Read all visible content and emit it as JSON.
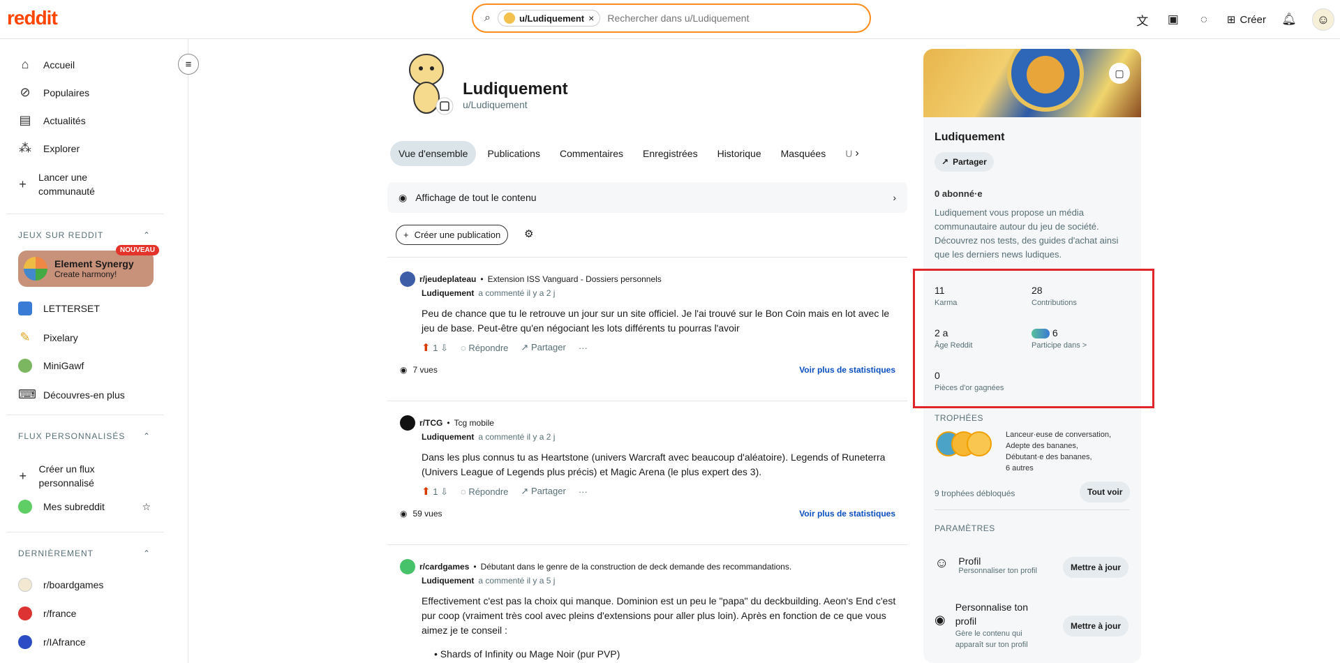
{
  "header": {
    "logo": "reddit",
    "search_chip": "u/Ludiquement",
    "search_placeholder": "Rechercher dans u/Ludiquement",
    "create_label": "Créer"
  },
  "sidebar": {
    "nav": [
      {
        "label": "Accueil",
        "icon": "home-icon"
      },
      {
        "label": "Populaires",
        "icon": "popular-icon"
      },
      {
        "label": "Actualités",
        "icon": "news-icon"
      },
      {
        "label": "Explorer",
        "icon": "explore-icon"
      },
      {
        "label": "Lancer une communauté",
        "icon": "plus-icon"
      }
    ],
    "games_title": "JEUX SUR REDDIT",
    "game_card": {
      "title": "Element Synergy",
      "subtitle": "Create harmony!",
      "badge": "NOUVEAU"
    },
    "games": [
      {
        "label": "LETTERSET"
      },
      {
        "label": "Pixelary"
      },
      {
        "label": "MiniGawf"
      },
      {
        "label": "Découvres-en plus"
      }
    ],
    "feeds_title": "FLUX PERSONNALISÉS",
    "feeds": [
      {
        "label": "Créer un flux personnalisé"
      },
      {
        "label": "Mes subreddit"
      }
    ],
    "recent_title": "DERNIÈREMENT",
    "recent": [
      {
        "label": "r/boardgames"
      },
      {
        "label": "r/france"
      },
      {
        "label": "r/IAfrance"
      }
    ]
  },
  "profile": {
    "name": "Ludiquement",
    "handle": "u/Ludiquement",
    "tabs": [
      "Vue d'ensemble",
      "Publications",
      "Commentaires",
      "Enregistrées",
      "Historique",
      "Masquées",
      "U"
    ],
    "banner": "Affichage de tout le contenu",
    "create_post": "Créer une publication"
  },
  "posts": [
    {
      "subreddit": "r/jeudeplateau",
      "title": "Extension ISS Vanguard - Dossiers personnels",
      "author": "Ludiquement",
      "meta": "a commenté il y a 2 j",
      "body": "Peu de chance que tu le retrouve un jour sur un site officiel. Je l'ai trouvé sur le Bon Coin mais en lot avec le jeu de base. Peut-être qu'en négociant les lots différents tu pourras l'avoir",
      "votes": "1",
      "reply": "Répondre",
      "share": "Partager",
      "views": "7 vues",
      "stats": "Voir plus de statistiques"
    },
    {
      "subreddit": "r/TCG",
      "title": "Tcg mobile",
      "author": "Ludiquement",
      "meta": "a commenté il y a 2 j",
      "body": "Dans les plus connus tu as Heartstone (univers Warcraft avec beaucoup d'aléatoire). Legends of Runeterra (Univers League of Legends plus précis) et Magic Arena (le plus expert des 3).",
      "votes": "1",
      "reply": "Répondre",
      "share": "Partager",
      "views": "59 vues",
      "stats": "Voir plus de statistiques"
    },
    {
      "subreddit": "r/cardgames",
      "title": "Débutant dans le genre de la construction de deck demande des recommandations.",
      "author": "Ludiquement",
      "meta": "a commenté il y a 5 j",
      "body": "Effectivement c'est pas la choix qui manque. Dominion est un peu le \"papa\" du deckbuilding. Aeon's End c'est pur coop (vraiment très cool avec pleins d'extensions pour aller plus loin). Après en fonction de ce que vous aimez je te conseil :",
      "bullet": "Shards of Infinity ou Mage Noir (pur PVP)"
    }
  ],
  "right": {
    "name": "Ludiquement",
    "share": "Partager",
    "subscribers": "0 abonné·e",
    "description": "Ludiquement vous propose un média communautaire autour du jeu de société. Découvrez nos tests, des guides d'achat ainsi que les derniers news ludiques.",
    "stats": {
      "karma_value": "11",
      "karma_label": "Karma",
      "contrib_value": "28",
      "contrib_label": "Contributions",
      "age_value": "2 a",
      "age_label": "Âge Reddit",
      "participates_value": "6",
      "participates_label": "Participe dans >",
      "gold_value": "0",
      "gold_label": "Pièces d'or gagnées"
    },
    "trophies_title": "TROPHÉES",
    "trophies_list": [
      "Lanceur·euse de conversation,",
      "Adepte des bananes,",
      "Débutant·e des bananes,",
      "6 autres"
    ],
    "trophies_count": "9 trophées débloqués",
    "see_all": "Tout voir",
    "settings_title": "PARAMÈTRES",
    "settings": [
      {
        "title": "Profil",
        "subtitle": "Personnaliser ton profil",
        "button": "Mettre à jour"
      },
      {
        "title": "Personnalise ton profil",
        "subtitle": "Gère le contenu qui apparaît sur ton profil",
        "button": "Mettre à jour"
      }
    ]
  },
  "colors": {
    "brand": "#ff4500",
    "highlight": "#e0252b",
    "link": "#0a4fc2"
  }
}
